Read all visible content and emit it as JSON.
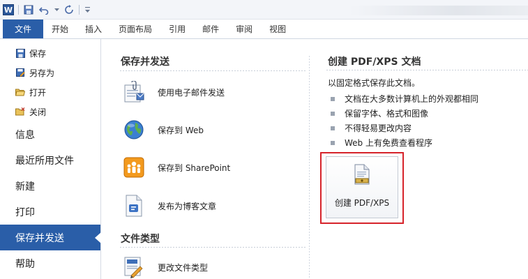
{
  "qat": {
    "app_logo": "W",
    "save_icon": "save-icon",
    "undo_icon": "undo-icon",
    "redo_icon": "repeat-icon",
    "customize_icon": "customize-qat-icon"
  },
  "ribbon": {
    "tabs": [
      "文件",
      "开始",
      "插入",
      "页面布局",
      "引用",
      "邮件",
      "审阅",
      "视图"
    ]
  },
  "nav": {
    "small_items": [
      {
        "label": "保存",
        "icon": "save-icon"
      },
      {
        "label": "另存为",
        "icon": "save-as-icon"
      },
      {
        "label": "打开",
        "icon": "open-folder-icon"
      },
      {
        "label": "关闭",
        "icon": "close-folder-icon"
      }
    ],
    "big_items": [
      "信息",
      "最近所用文件",
      "新建",
      "打印",
      "保存并发送",
      "帮助"
    ],
    "active": "保存并发送"
  },
  "middle": {
    "save_send_title": "保存并发送",
    "options": [
      {
        "label": "使用电子邮件发送",
        "icon": "email-attachment-icon"
      },
      {
        "label": "保存到 Web",
        "icon": "globe-icon"
      },
      {
        "label": "保存到 SharePoint",
        "icon": "sharepoint-icon"
      },
      {
        "label": "发布为博客文章",
        "icon": "blog-post-icon"
      }
    ],
    "file_types_title": "文件类型",
    "file_types": [
      {
        "label": "更改文件类型",
        "icon": "change-file-type-icon"
      }
    ]
  },
  "detail": {
    "title": "创建 PDF/XPS 文档",
    "description": "以固定格式保存此文档。",
    "bullets": [
      "文档在大多数计算机上的外观都相同",
      "保留字体、格式和图像",
      "不得轻易更改内容",
      "Web 上有免费查看程序"
    ],
    "button_label": "创建 PDF/XPS",
    "button_icon": "pdf-xps-document-icon",
    "highlight_color": "#d6232a"
  },
  "colors": {
    "accent": "#2a5ea8"
  }
}
